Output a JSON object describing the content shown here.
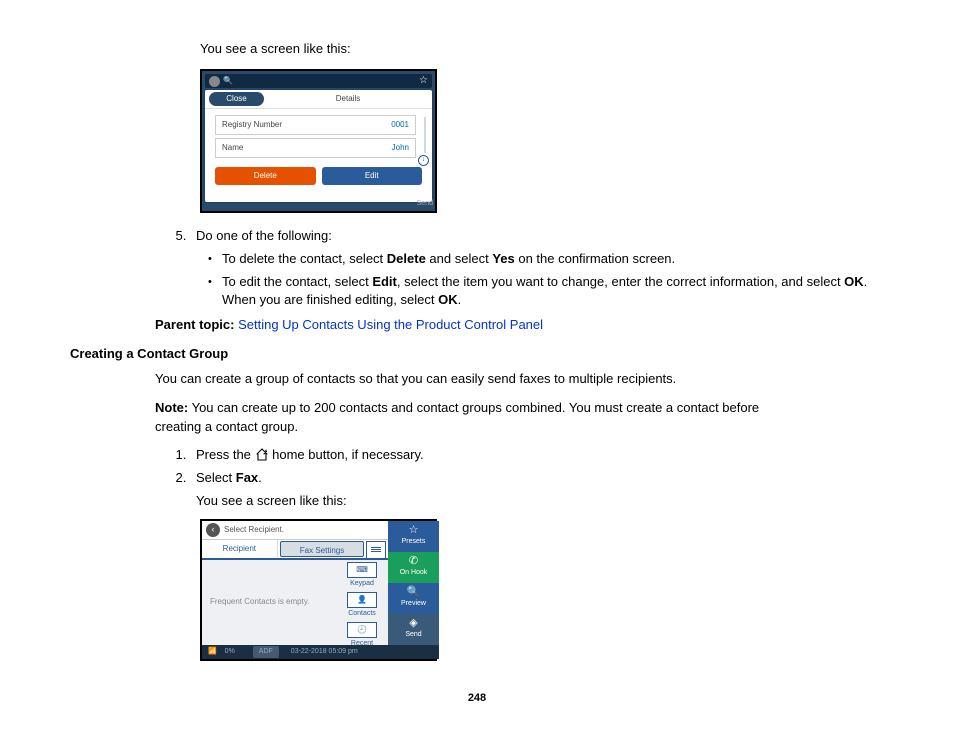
{
  "intro_line": "You see a screen like this:",
  "ss1": {
    "search_placeholder": "Search...",
    "close": "Close",
    "details": "Details",
    "reg_label": "Registry Number",
    "reg_value": "0001",
    "name_label": "Name",
    "name_value": "John",
    "delete": "Delete",
    "edit": "Edit",
    "send": "Send"
  },
  "step5_lead": "Do one of the following:",
  "bullet_delete_a": "To delete the contact, select ",
  "bullet_delete_b": "Delete",
  "bullet_delete_c": " and select ",
  "bullet_delete_d": "Yes",
  "bullet_delete_e": " on the confirmation screen.",
  "bullet_edit_a": "To edit the contact, select ",
  "bullet_edit_b": "Edit",
  "bullet_edit_c": ", select the item you want to change, enter the correct information, and select ",
  "bullet_edit_d": "OK",
  "bullet_edit_e": ". When you are finished editing, select ",
  "bullet_edit_f": "OK",
  "bullet_edit_g": ".",
  "parent_label": "Parent topic: ",
  "parent_link": "Setting Up Contacts Using the Product Control Panel",
  "heading_group": "Creating a Contact Group",
  "group_intro": "You can create a group of contacts so that you can easily send faxes to multiple recipients.",
  "note_label": "Note:",
  "note_text": " You can create up to 200 contacts and contact groups combined. You must create a contact before creating a contact group.",
  "step1_a": "Press the ",
  "step1_b": " home button, if necessary.",
  "step2_a": "Select ",
  "step2_b": "Fax",
  "step2_c": ".",
  "step2_aux": "You see a screen like this:",
  "ss2": {
    "select_recipient": "Select Recipient.",
    "tab_recipient": "Recipient",
    "tab_fax": "Fax Settings",
    "keypad": "Keypad",
    "contacts": "Contacts",
    "recent": "Recent",
    "freq_empty": "Frequent Contacts is empty.",
    "presets": "Presets",
    "onhook": "On Hook",
    "preview": "Preview",
    "send": "Send",
    "status_pct": "0%",
    "status_adf": "ADF",
    "status_time": "03-22-2018 05:09 pm"
  },
  "pagenum": "248"
}
